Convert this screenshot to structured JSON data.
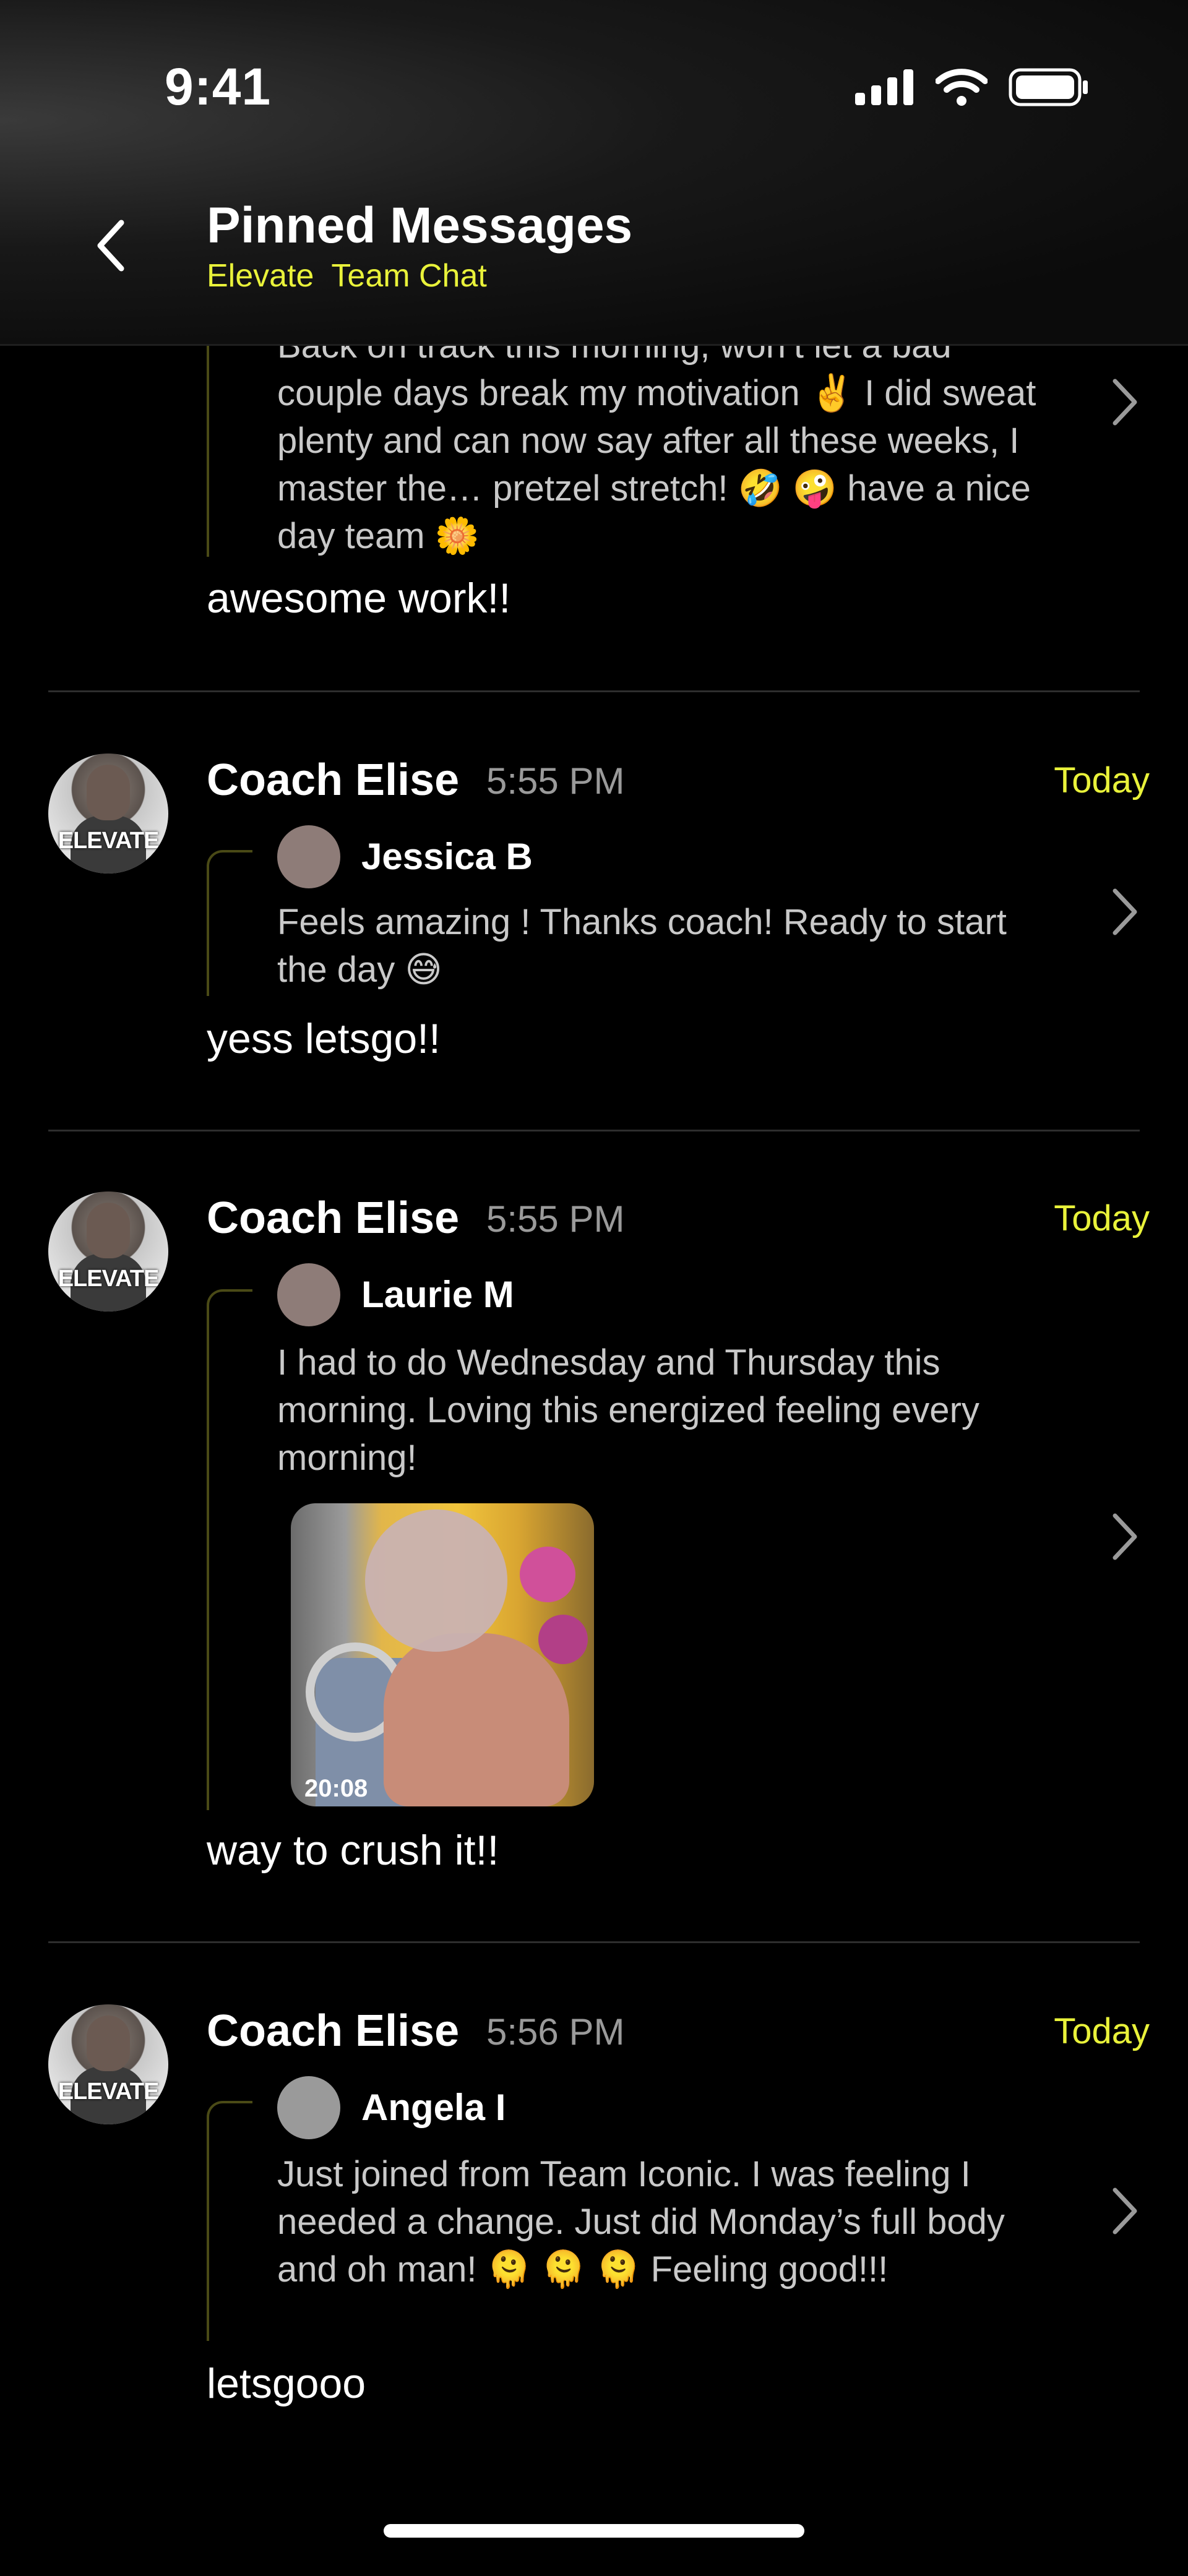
{
  "status": {
    "time": "9:41"
  },
  "header": {
    "title": "Pinned Messages",
    "subtitle": "Elevate  Team Chat"
  },
  "top_message": {
    "quote_text": "Back on track this morning, won’t let a bad couple days break my motivation ✌️ I did sweat plenty and can now say after all these weeks, I master the… pretzel stretch! 🤣 🤪 have a nice day team 🌼",
    "reply": "awesome work!!"
  },
  "messages": [
    {
      "sender": "Coach Elise",
      "time": "5:55 PM",
      "date": "Today",
      "avatar_label": "ELEVATE",
      "quoted_author": "Jessica B",
      "quoted_text": "Feels amazing ! Thanks coach! Ready to start the day 😅",
      "reply": "yess letsgo!!"
    },
    {
      "sender": "Coach Elise",
      "time": "5:55 PM",
      "date": "Today",
      "avatar_label": "ELEVATE",
      "quoted_author": "Laurie M",
      "quoted_text": "I had to do Wednesday and Thursday this morning. Loving this energized feeling every morning!",
      "photo_timestamp": "20:08",
      "reply": "way to crush it!!"
    },
    {
      "sender": "Coach Elise",
      "time": "5:56 PM",
      "date": "Today",
      "avatar_label": "ELEVATE",
      "quoted_author": "Angela I",
      "quoted_text": "Just joined from Team Iconic. I was feeling I needed a change. Just did Monday’s full body and oh man! 🫠 🫠 🫠 Feeling good!!!",
      "reply": "letsgooo"
    }
  ],
  "icons": {
    "back": "chevron-left-icon",
    "open": "chevron-right-icon",
    "signal": "cellular-signal-icon",
    "wifi": "wifi-icon",
    "battery": "battery-icon"
  },
  "colors": {
    "accent": "#e9f23a",
    "background": "#000000",
    "muted_text": "#c9c9c9"
  }
}
